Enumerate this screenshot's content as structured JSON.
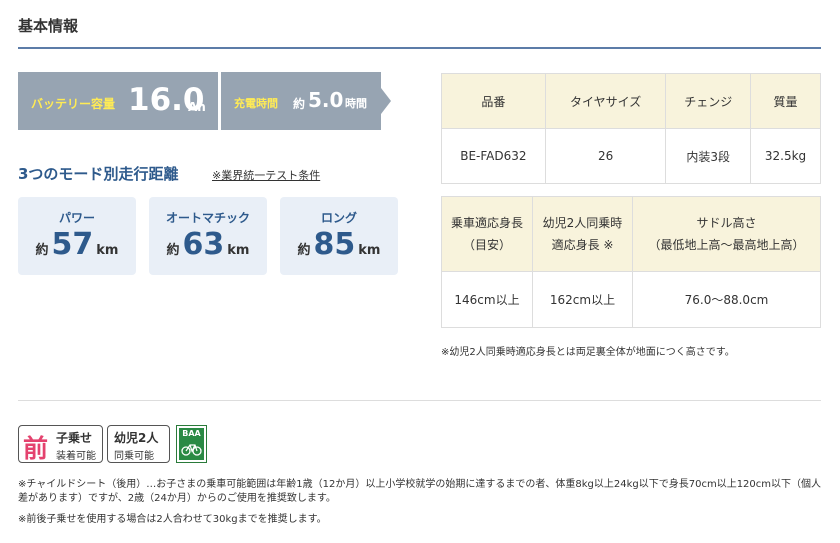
{
  "section": {
    "title": "基本情報"
  },
  "battery": {
    "label": "バッテリー容量",
    "value": "16.0",
    "unit": "Ah"
  },
  "charge": {
    "label": "充電時間",
    "prefix": "約",
    "value": "5.0",
    "unit": "時間"
  },
  "modes": {
    "title": "3つのモード別走行距離",
    "note": "※業界統一テスト条件",
    "items": [
      {
        "name": "パワー",
        "prefix": "約",
        "value": "57",
        "unit": "km"
      },
      {
        "name": "オートマチック",
        "prefix": "約",
        "value": "63",
        "unit": "km"
      },
      {
        "name": "ロング",
        "prefix": "約",
        "value": "85",
        "unit": "km"
      }
    ]
  },
  "spec_table": {
    "headers": [
      "品番",
      "タイヤサイズ",
      "チェンジ",
      "質量"
    ],
    "row": [
      "BE-FAD632",
      "26",
      "内装3段",
      "32.5kg"
    ]
  },
  "height_table": {
    "headers": [
      {
        "line1": "乗車適応身長",
        "line2": "（目安）"
      },
      {
        "line1": "幼児2人同乗時",
        "line2": "適応身長 ※"
      },
      {
        "line1": "サドル高さ",
        "line2": "（最低地上高〜最高地上高）"
      }
    ],
    "row": [
      "146cm以上",
      "162cm以上",
      "76.0〜88.0cm"
    ]
  },
  "table_note": "※幼児2人同乗時適応身長とは両足裏全体が地面につく高さです。",
  "badges": {
    "front_seat": {
      "kanji": "前",
      "line1": "子乗せ",
      "line2": "装着可能"
    },
    "two_kids": {
      "line1": "幼児2人",
      "line2": "同乗可能"
    },
    "baa": {
      "text": "BAA"
    }
  },
  "footnotes": {
    "note1": "※チャイルドシート（後用）…お子さまの乗車可能範囲は年齢1歳（12か月）以上小学校就学の始期に達するまでの者、体重8kg以上24kg以下で身長70cm以上120cm以下（個人差があります）ですが、2歳（24か月）からのご使用を推奨致します。",
    "note2": "※前後子乗せを使用する場合は2人合わせて30kgまでを推奨します。"
  },
  "colors": {
    "accent": "#2e5a8c",
    "battery_bg": "#97a4b2",
    "battery_text": "#ffeb55",
    "card_bg": "#e9eff7",
    "header_bg": "#f8f3dc",
    "badge_pink": "#e4426e",
    "baa_green": "#2a8a44"
  },
  "icons": {
    "baa": "bicycle-icon"
  }
}
